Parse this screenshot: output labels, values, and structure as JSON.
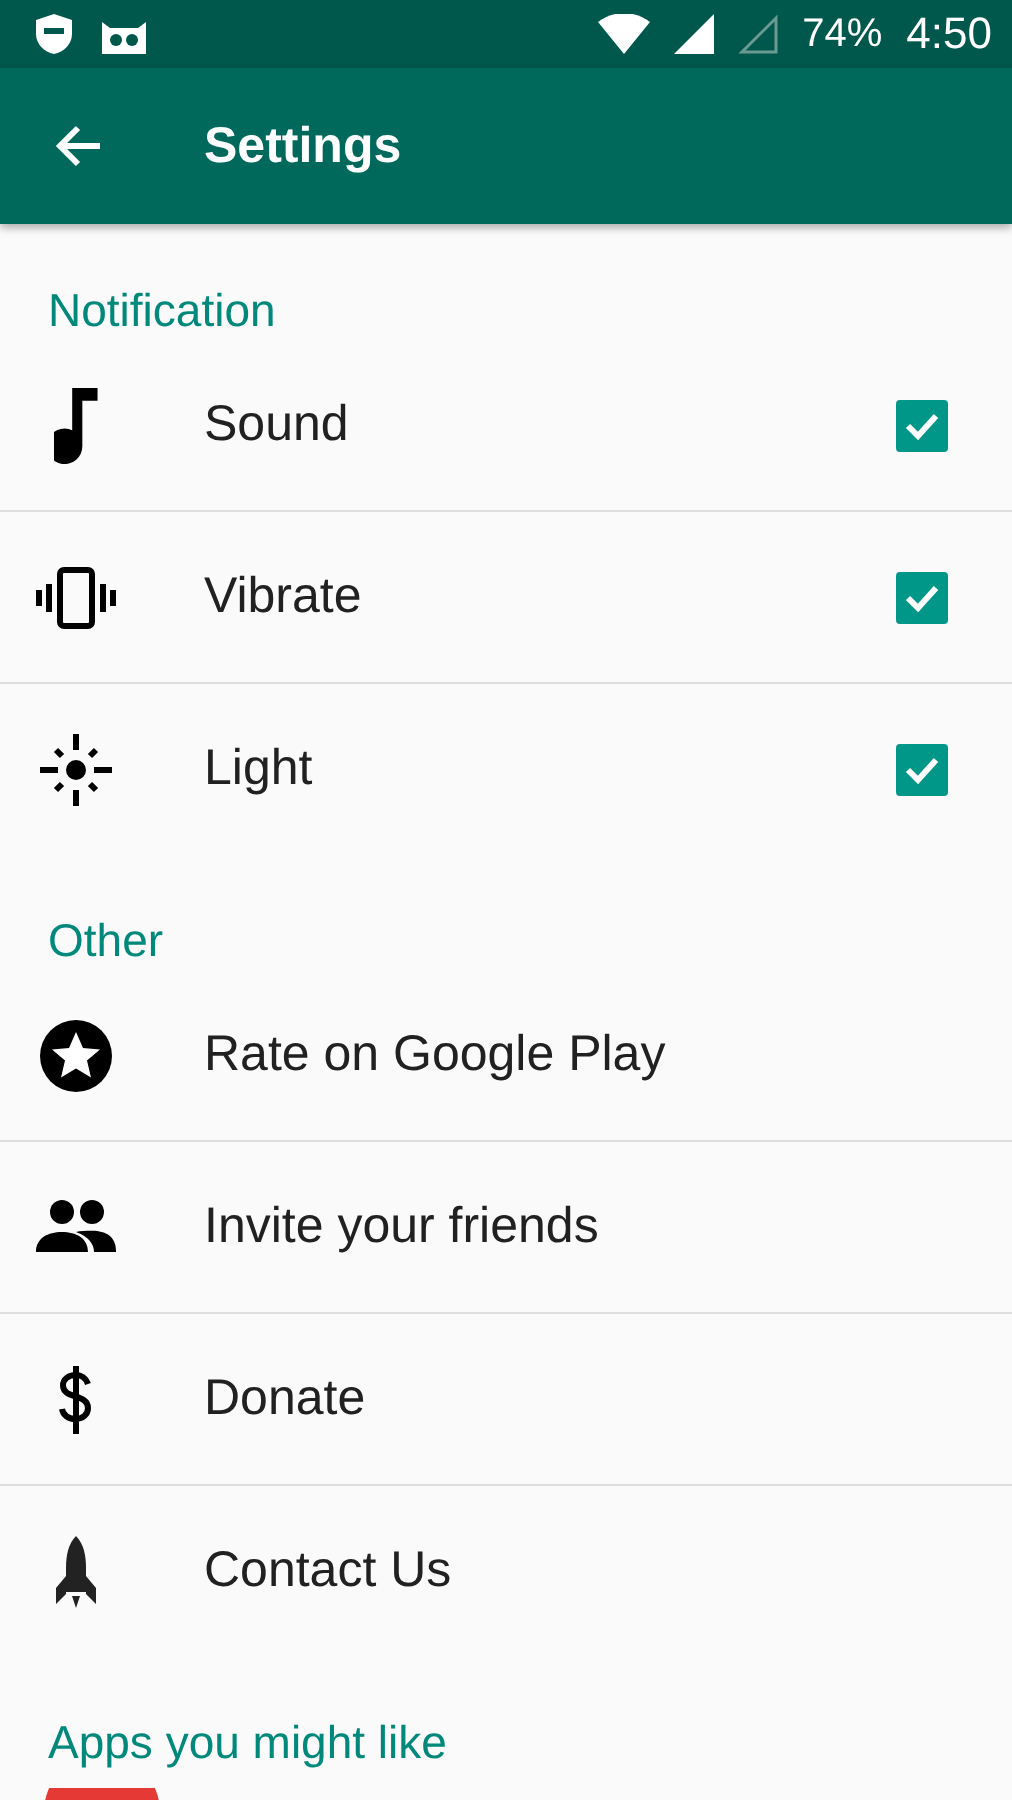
{
  "status_bar": {
    "battery": "74%",
    "time": "4:50"
  },
  "app_bar": {
    "title": "Settings"
  },
  "sections": [
    {
      "title": "Notification",
      "items": [
        {
          "kind": "checkbox",
          "label": "Sound",
          "checked": true
        },
        {
          "kind": "checkbox",
          "label": "Vibrate",
          "checked": true
        },
        {
          "kind": "checkbox",
          "label": "Light",
          "checked": true
        }
      ]
    },
    {
      "title": "Other",
      "items": [
        {
          "kind": "link",
          "label": "Rate on Google Play"
        },
        {
          "kind": "link",
          "label": "Invite your friends"
        },
        {
          "kind": "link",
          "label": "Donate"
        },
        {
          "kind": "link",
          "label": "Contact Us"
        }
      ]
    },
    {
      "title": "Apps you might like"
    }
  ]
}
